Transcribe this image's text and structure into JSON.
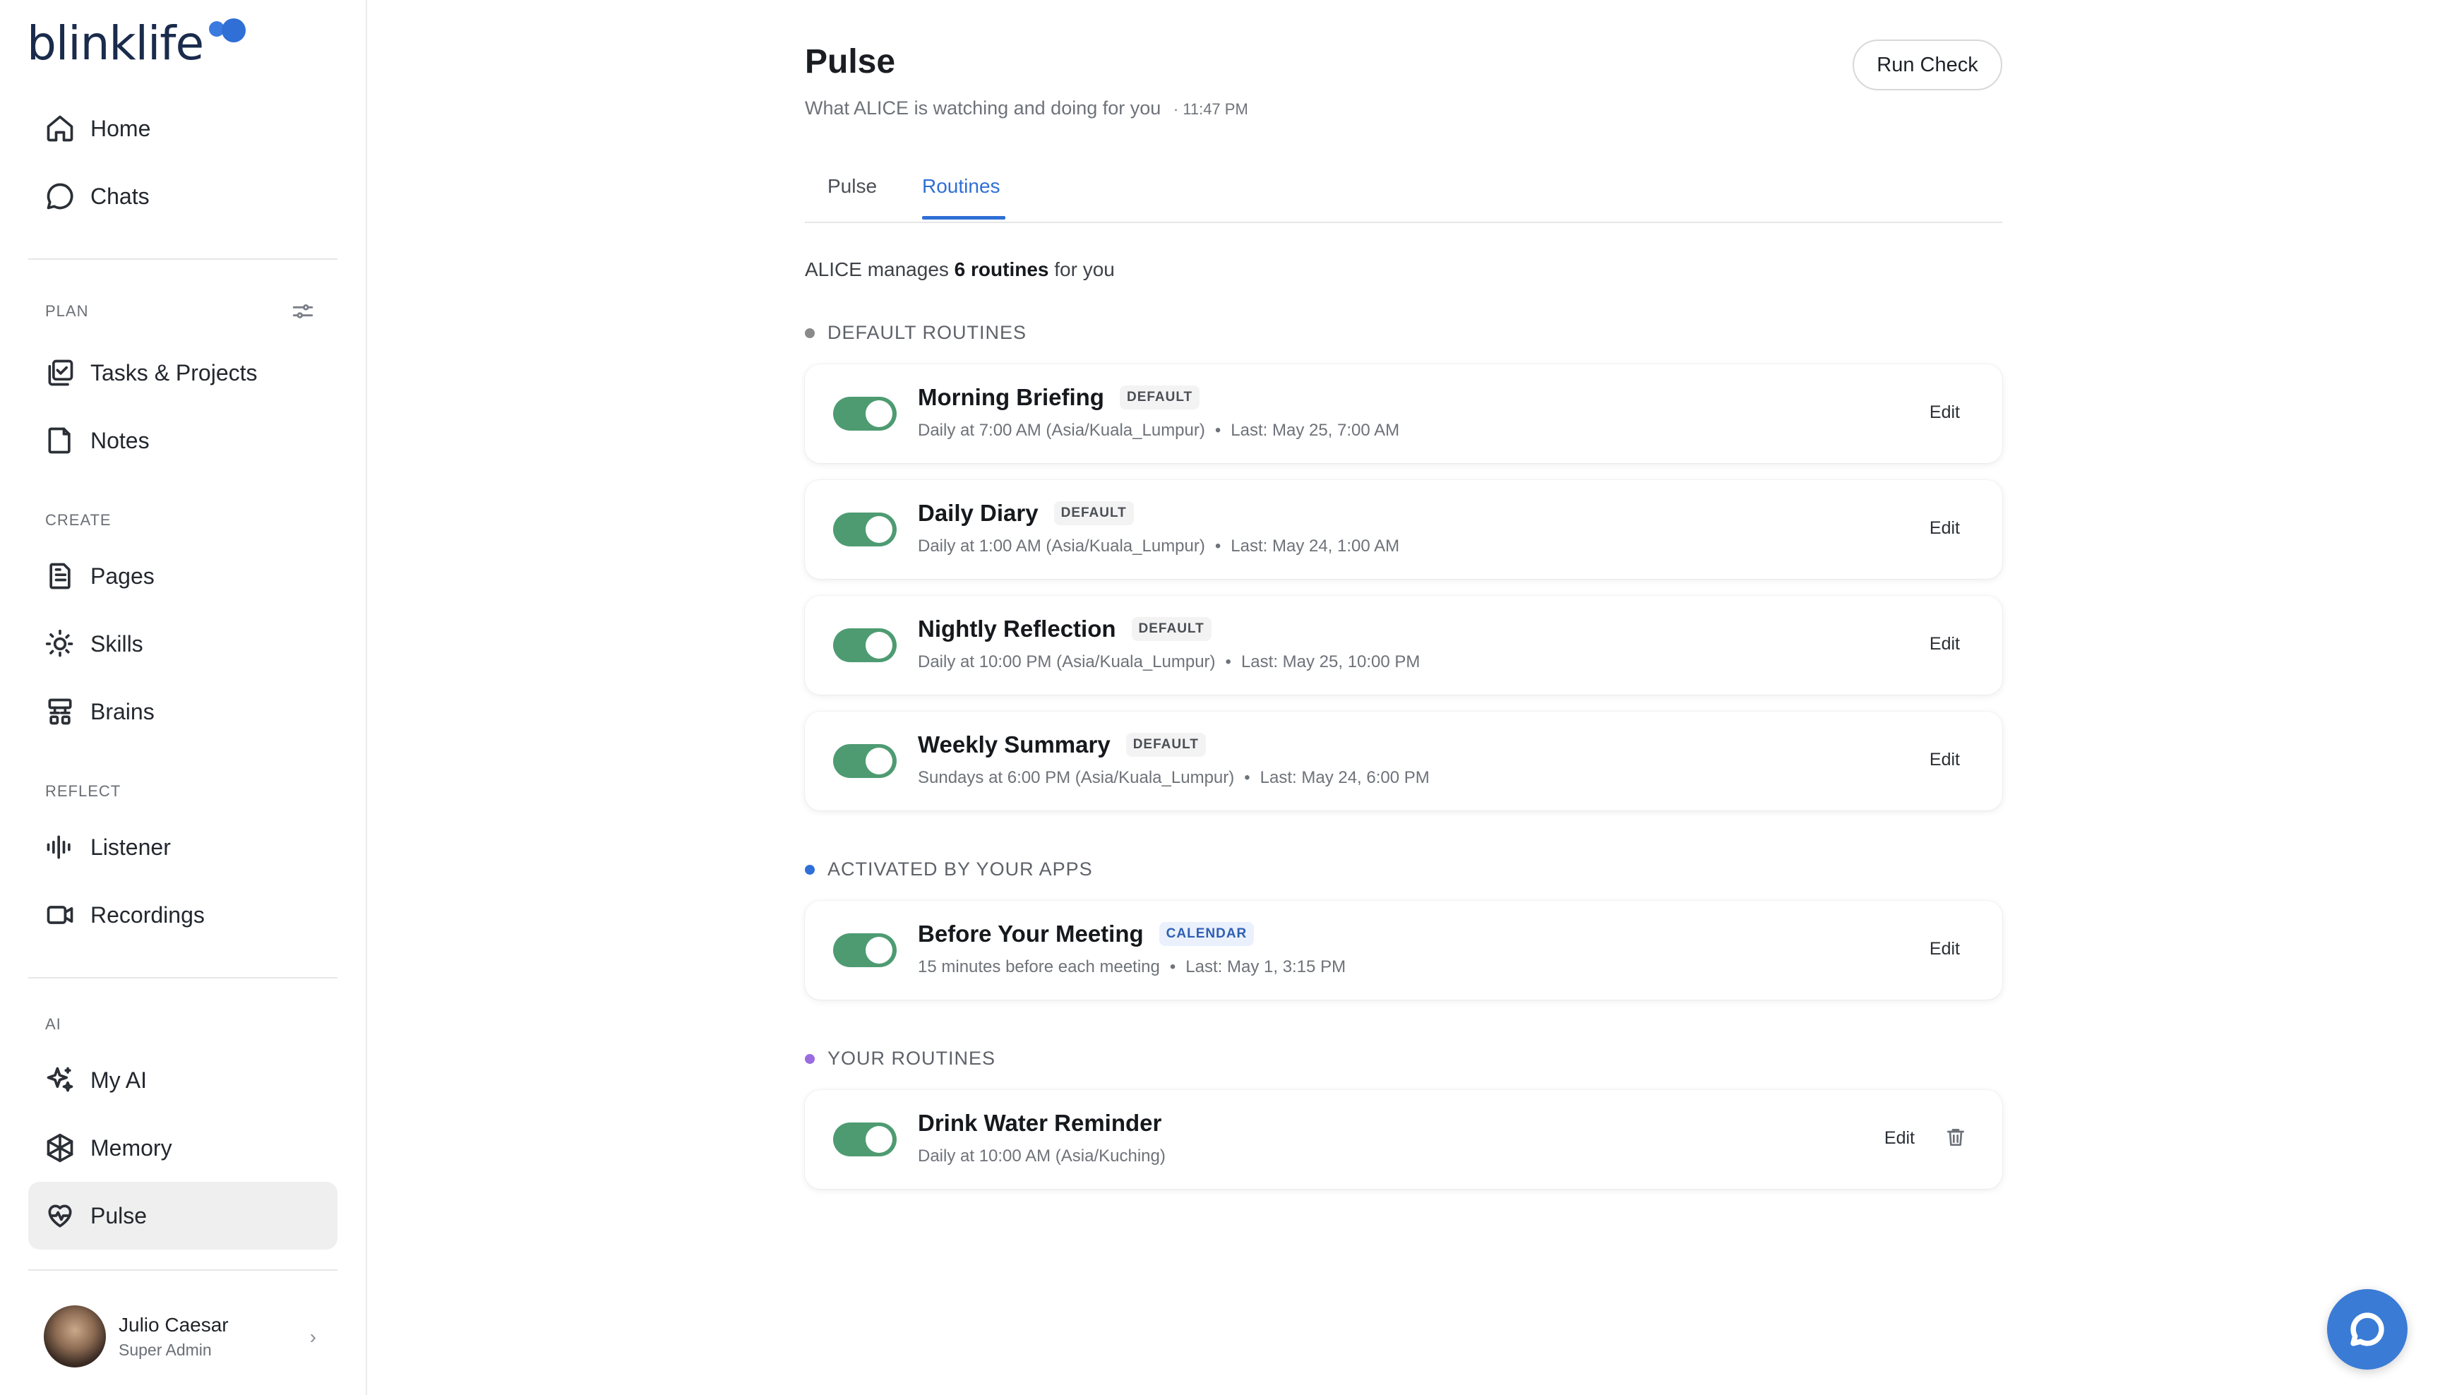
{
  "brand": {
    "name": "blinklife",
    "accent": "#2f6fd6"
  },
  "sidebar": {
    "top_items": [
      {
        "label": "Home",
        "icon": "home-icon"
      },
      {
        "label": "Chats",
        "icon": "chat-bubble-icon"
      }
    ],
    "sections": {
      "plan": "PLAN",
      "create": "CREATE",
      "reflect": "REFLECT",
      "ai": "AI"
    },
    "plan_items": [
      {
        "label": "Tasks & Projects",
        "icon": "tasks-icon"
      },
      {
        "label": "Notes",
        "icon": "note-icon"
      }
    ],
    "create_items": [
      {
        "label": "Pages",
        "icon": "page-icon"
      },
      {
        "label": "Skills",
        "icon": "skills-icon"
      },
      {
        "label": "Brains",
        "icon": "brains-icon"
      }
    ],
    "reflect_items": [
      {
        "label": "Listener",
        "icon": "waveform-icon"
      },
      {
        "label": "Recordings",
        "icon": "video-icon"
      }
    ],
    "ai_items": [
      {
        "label": "My AI",
        "icon": "sparkle-icon"
      },
      {
        "label": "Memory",
        "icon": "memory-icon"
      },
      {
        "label": "Pulse",
        "icon": "heart-pulse-icon",
        "active": true
      }
    ],
    "user": {
      "name": "Julio Caesar",
      "role": "Super Admin"
    }
  },
  "header": {
    "title": "Pulse",
    "subtitle": "What ALICE is watching and doing for you",
    "time": "· 11:47 PM",
    "run_check_label": "Run Check"
  },
  "tabs": [
    {
      "label": "Pulse",
      "active": false
    },
    {
      "label": "Routines",
      "active": true
    }
  ],
  "summary": {
    "prefix": "ALICE manages ",
    "count": "6 routines",
    "suffix": " for you"
  },
  "groups": {
    "default": {
      "label": "DEFAULT ROUTINES",
      "dot_color": "#8a8a8a"
    },
    "apps": {
      "label": "ACTIVATED BY YOUR APPS",
      "dot_color": "#2f6fd6"
    },
    "yours": {
      "label": "YOUR ROUTINES",
      "dot_color": "#9b6be0"
    }
  },
  "routines": [
    {
      "title": "Morning Briefing",
      "badge": "DEFAULT",
      "schedule": "Daily at 7:00 AM (Asia/Kuala_Lumpur)",
      "last": "Last: May 25, 7:00 AM",
      "edit": "Edit",
      "enabled": true
    },
    {
      "title": "Daily Diary",
      "badge": "DEFAULT",
      "schedule": "Daily at 1:00 AM (Asia/Kuala_Lumpur)",
      "last": "Last: May 24, 1:00 AM",
      "edit": "Edit",
      "enabled": true
    },
    {
      "title": "Nightly Reflection",
      "badge": "DEFAULT",
      "schedule": "Daily at 10:00 PM (Asia/Kuala_Lumpur)",
      "last": "Last: May 25, 10:00 PM",
      "edit": "Edit",
      "enabled": true
    },
    {
      "title": "Weekly Summary",
      "badge": "DEFAULT",
      "schedule": "Sundays at 6:00 PM (Asia/Kuala_Lumpur)",
      "last": "Last: May 24, 6:00 PM",
      "edit": "Edit",
      "enabled": true
    },
    {
      "title": "Before Your Meeting",
      "badge": "CALENDAR",
      "schedule": "15 minutes before each meeting",
      "last": "Last: May 1, 3:15 PM",
      "edit": "Edit",
      "enabled": true
    },
    {
      "title": "Drink Water Reminder",
      "schedule": "Daily at 10:00 AM (Asia/Kuching)",
      "edit": "Edit",
      "enabled": true
    }
  ],
  "meta_separator": "•"
}
